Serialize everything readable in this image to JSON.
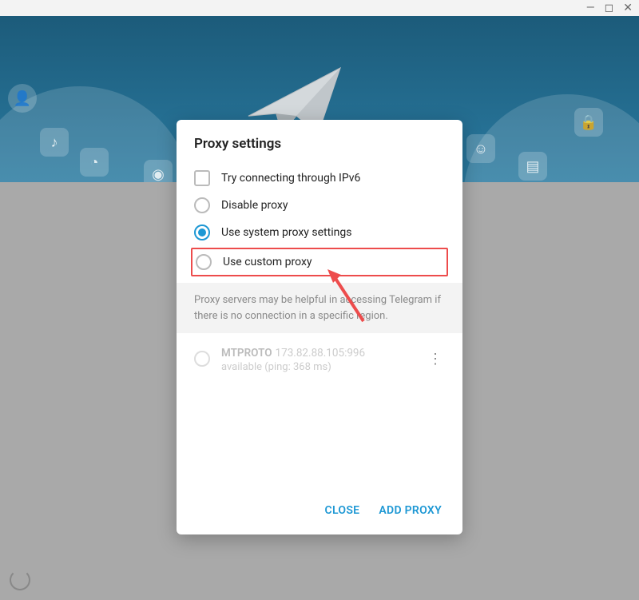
{
  "window": {
    "minimize": "—",
    "maximize": "◻",
    "close": "✕"
  },
  "dialog": {
    "title": "Proxy settings",
    "options": {
      "ipv6": "Try connecting through IPv6",
      "disable": "Disable proxy",
      "system": "Use system proxy settings",
      "custom": "Use custom proxy"
    },
    "info": "Proxy servers may be helpful in accessing Telegram if there is no connection in a specific region.",
    "proxy": {
      "protocol": "MTPROTO",
      "address": "173.82.88.105:996",
      "status": "available (ping: 368 ms)"
    },
    "footer": {
      "close": "CLOSE",
      "add": "ADD PROXY"
    }
  }
}
